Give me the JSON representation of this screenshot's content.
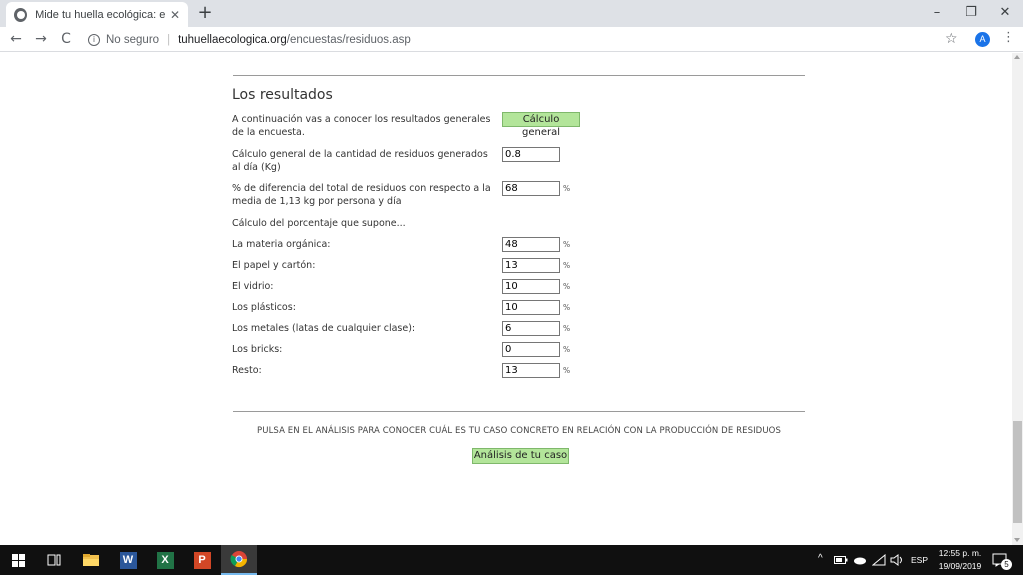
{
  "browser": {
    "tab_title": "Mide tu huella ecológica: encues",
    "tab_close": "✕",
    "new_tab": "+",
    "window_controls": {
      "minimize": "–",
      "restore": "❐",
      "close": "✕"
    },
    "nav": {
      "back": "←",
      "forward": "→",
      "reload": "C"
    },
    "security_label": "No seguro",
    "url_host": "tuhuellaecologica.org",
    "url_path": "/encuestas/residuos.asp",
    "star": "☆",
    "profile_initial": "A",
    "menu": "⋮"
  },
  "page": {
    "section_title": "Los resultados",
    "intro_label": "A continuación vas a conocer los resultados generales de la encuesta.",
    "general_button": "Cálculo general",
    "rows": [
      {
        "label": "Cálculo general de la cantidad de residuos generados al día (Kg)",
        "value": "0.8",
        "unit": ""
      },
      {
        "label": "% de diferencia del total de residuos con respecto a la media de 1,13 kg por persona y día",
        "value": "68",
        "unit": "%"
      }
    ],
    "percentage_heading": "Cálculo del porcentaje que supone...",
    "materials": [
      {
        "label": "La materia orgánica:",
        "value": "48",
        "unit": "%"
      },
      {
        "label": "El papel y cartón:",
        "value": "13",
        "unit": "%"
      },
      {
        "label": "El vidrio:",
        "value": "10",
        "unit": "%"
      },
      {
        "label": "Los plásticos:",
        "value": "10",
        "unit": "%"
      },
      {
        "label": "Los metales (latas de cualquier clase):",
        "value": "6",
        "unit": "%"
      },
      {
        "label": "Los bricks:",
        "value": "0",
        "unit": "%"
      },
      {
        "label": "Resto:",
        "value": "13",
        "unit": "%"
      }
    ],
    "analysis_prompt": "PULSA EN EL ANÁLISIS PARA CONOCER CUÁL ES TU CASO CONCRETO EN RELACIÓN CON LA PRODUCCIÓN DE RESIDUOS",
    "analysis_button": "Análisis de tu caso"
  },
  "taskbar": {
    "language": "ESP",
    "time": "12:55 p. m.",
    "date": "19/09/2019",
    "notification_count": "5",
    "tray_chevron": "^",
    "word_letter": "W",
    "excel_letter": "X",
    "powerpoint_letter": "P"
  },
  "colors": {
    "button_green": "#b3e59a",
    "taskbar": "#101010",
    "tab_bar": "#dee1e6",
    "profile_blue": "#1a73e8"
  }
}
